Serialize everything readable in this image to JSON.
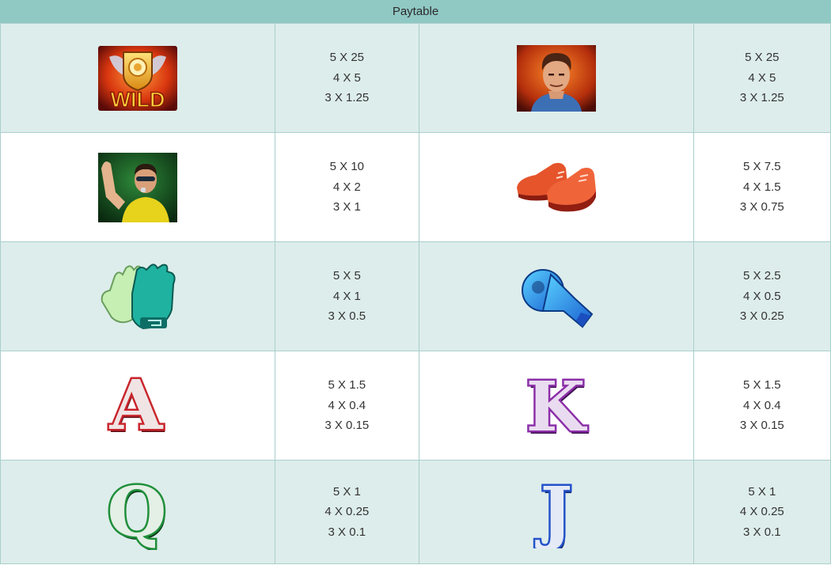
{
  "header": {
    "title": "Paytable"
  },
  "rows": [
    {
      "left": {
        "symbol": "wild-icon",
        "label": "WILD",
        "pays": [
          "5 X 25",
          "4 X 5",
          "3 X 1.25"
        ]
      },
      "right": {
        "symbol": "player-portrait-icon",
        "pays": [
          "5 X 25",
          "4 X 5",
          "3 X 1.25"
        ]
      }
    },
    {
      "left": {
        "symbol": "referee-icon",
        "pays": [
          "5 X 10",
          "4 X 2",
          "3 X 1"
        ]
      },
      "right": {
        "symbol": "boots-icon",
        "pays": [
          "5 X 7.5",
          "4 X 1.5",
          "3 X 0.75"
        ]
      }
    },
    {
      "left": {
        "symbol": "gloves-icon",
        "pays": [
          "5 X 5",
          "4 X 1",
          "3 X 0.5"
        ]
      },
      "right": {
        "symbol": "whistle-icon",
        "pays": [
          "5 X 2.5",
          "4 X 0.5",
          "3 X 0.25"
        ]
      }
    },
    {
      "left": {
        "symbol": "letter-a-icon",
        "label": "A",
        "color": "#c9252d",
        "pays": [
          "5 X 1.5",
          "4 X 0.4",
          "3 X 0.15"
        ]
      },
      "right": {
        "symbol": "letter-k-icon",
        "label": "K",
        "color": "#8b2fa8",
        "pays": [
          "5 X 1.5",
          "4 X 0.4",
          "3 X 0.15"
        ]
      }
    },
    {
      "left": {
        "symbol": "letter-q-icon",
        "label": "Q",
        "color": "#1f8f3a",
        "pays": [
          "5 X 1",
          "4 X 0.25",
          "3 X 0.1"
        ]
      },
      "right": {
        "symbol": "letter-j-icon",
        "label": "J",
        "color": "#2352c9",
        "pays": [
          "5 X 1",
          "4 X 0.25",
          "3 X 0.1"
        ]
      }
    }
  ]
}
